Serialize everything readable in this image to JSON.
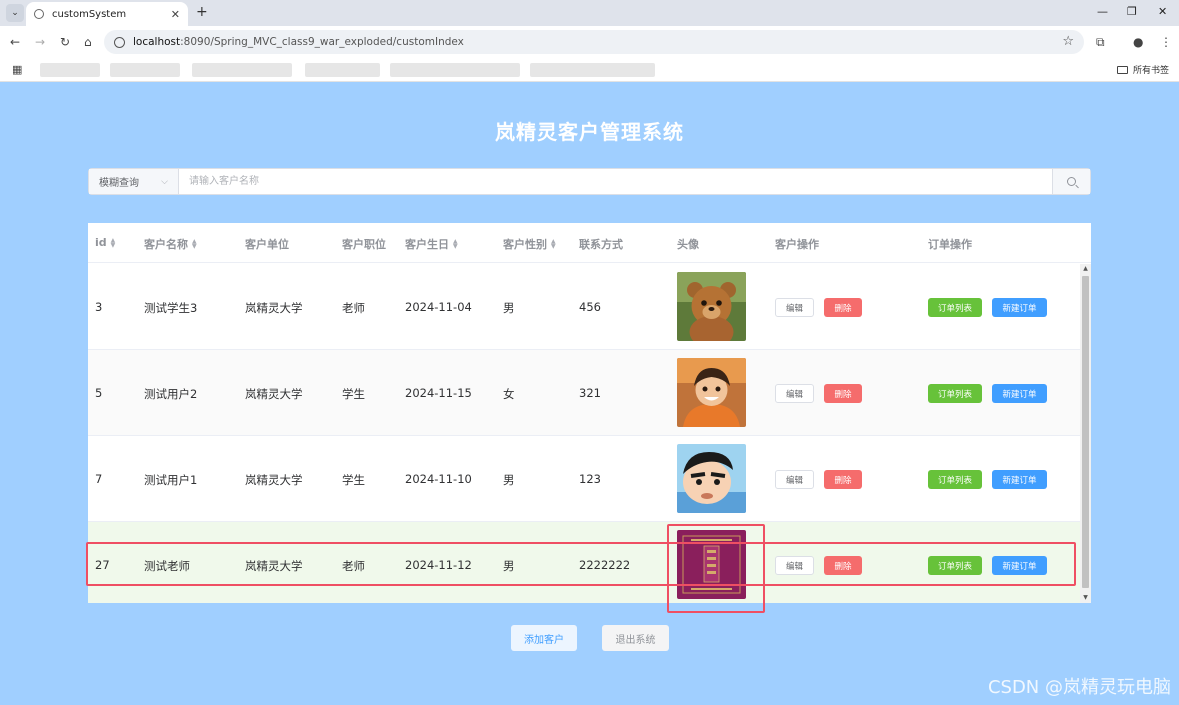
{
  "browser": {
    "tab_title": "customSystem",
    "new_tab": "+",
    "url_host": "localhost",
    "url_path": ":8090/Spring_MVC_class9_war_exploded/customIndex",
    "all_bookmarks": "所有书签"
  },
  "page": {
    "title": "岚精灵客户管理系统"
  },
  "search": {
    "mode_label": "模糊查询",
    "placeholder": "请输入客户名称"
  },
  "table": {
    "headers": {
      "id": "id",
      "name": "客户名称",
      "unit": "客户单位",
      "position": "客户职位",
      "birthday": "客户生日",
      "gender": "客户性别",
      "contact": "联系方式",
      "avatar": "头像",
      "customer_ops": "客户操作",
      "order_ops": "订单操作"
    },
    "buttons": {
      "edit": "编辑",
      "delete": "删除",
      "order_list": "订单列表",
      "new_order": "新建订单"
    },
    "rows": [
      {
        "id": "3",
        "name": "测试学生3",
        "unit": "岚精灵大学",
        "position": "老师",
        "birthday": "2024-11-04",
        "gender": "男",
        "contact": "456",
        "avatar": "bear-avatar"
      },
      {
        "id": "5",
        "name": "测试用户2",
        "unit": "岚精灵大学",
        "position": "学生",
        "birthday": "2024-11-15",
        "gender": "女",
        "contact": "321",
        "avatar": "anime-boy-avatar"
      },
      {
        "id": "7",
        "name": "测试用户1",
        "unit": "岚精灵大学",
        "position": "学生",
        "birthday": "2024-11-10",
        "gender": "男",
        "contact": "123",
        "avatar": "cartoon-boy-avatar"
      },
      {
        "id": "27",
        "name": "测试老师",
        "unit": "岚精灵大学",
        "position": "老师",
        "birthday": "2024-11-12",
        "gender": "男",
        "contact": "2222222",
        "avatar": "book-cover-avatar"
      }
    ]
  },
  "actions": {
    "add_customer": "添加客户",
    "exit_system": "退出系统"
  },
  "watermark": "CSDN @岚精灵玩电脑",
  "colors": {
    "page_bg": "#a0cfff",
    "primary": "#409eff",
    "success": "#67c23a",
    "danger": "#f56c6c",
    "annotation": "#ef4f63"
  }
}
